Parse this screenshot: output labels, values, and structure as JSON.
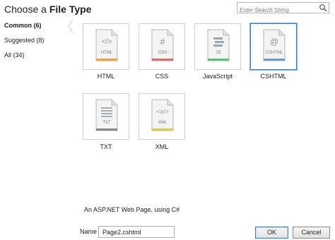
{
  "header": {
    "title_prefix": "Choose a ",
    "title_emph": "File Type",
    "search_placeholder": "Enter Search String"
  },
  "sidebar": {
    "items": [
      {
        "label": "Common (6)",
        "selected": true
      },
      {
        "label": "Suggested (8)",
        "selected": false
      },
      {
        "label": "All (34)",
        "selected": false
      }
    ]
  },
  "file_types": [
    {
      "label": "HTML",
      "badge": "HTML",
      "glyph": "</>",
      "accent": "#f0a33a",
      "selected": false
    },
    {
      "label": "CSS",
      "badge": "CSS",
      "glyph": "#",
      "accent": "#e06a6a",
      "selected": false
    },
    {
      "label": "JavaScript",
      "badge": "JS",
      "glyph": "script-icon",
      "accent": "#5fbf7a",
      "selected": false
    },
    {
      "label": "CSHTML",
      "badge": "CSHTML",
      "glyph": "@",
      "accent": "#6b9ad6",
      "selected": true
    },
    {
      "label": "TXT",
      "badge": "TXT",
      "glyph": "lines-icon",
      "accent": "#8a8a8a",
      "selected": false
    },
    {
      "label": "XML",
      "badge": "XML",
      "glyph": "<x/>",
      "accent": "#d6cf4a",
      "selected": false
    }
  ],
  "description": "An ASP.NET Web Page, using C#",
  "footer": {
    "name_label": "Name",
    "name_value": "Page2.cshtml",
    "ok_label": "OK",
    "cancel_label": "Cancel"
  },
  "colors": {
    "selection_border": "#3b7fd6",
    "tile_border": "#d2d2d2"
  }
}
